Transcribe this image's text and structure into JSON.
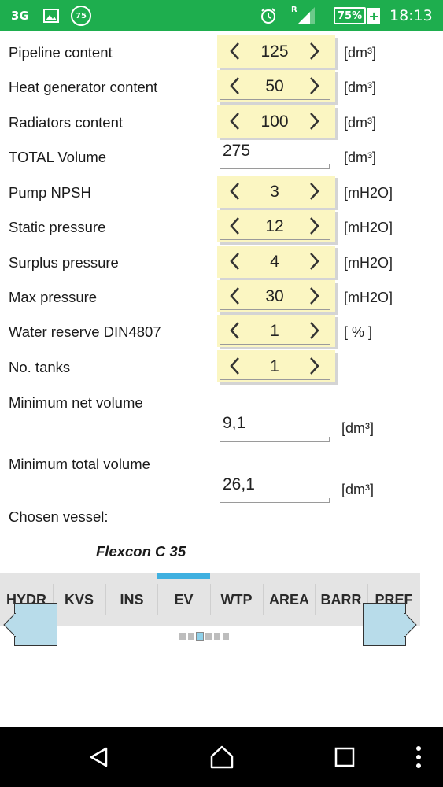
{
  "status_bar": {
    "network": "3G",
    "notification_badge": "75",
    "roaming": "R",
    "battery": "75%",
    "time": "18:13",
    "icons": [
      "network-3g-icon",
      "image-icon",
      "notification-75-icon",
      "alarm-icon",
      "signal-icon",
      "battery-charging-icon"
    ]
  },
  "form": {
    "rows": [
      {
        "label": "Pipeline content",
        "value": "125",
        "unit": "[dm³]"
      },
      {
        "label": "Heat generator content",
        "value": "50",
        "unit": "[dm³]"
      },
      {
        "label": "Radiators content",
        "value": "100",
        "unit": "[dm³]"
      },
      {
        "label": "TOTAL Volume",
        "value": "275",
        "unit": "[dm³]"
      },
      {
        "label": "Pump NPSH",
        "value": "3",
        "unit": "[mH2O]"
      },
      {
        "label": "Static pressure",
        "value": "12",
        "unit": "[mH2O]"
      },
      {
        "label": "Surplus pressure",
        "value": "4",
        "unit": "[mH2O]"
      },
      {
        "label": "Max pressure",
        "value": "30",
        "unit": "[mH2O]"
      },
      {
        "label": "Water reserve DIN4807",
        "value": "1",
        "unit": "[ % ]"
      },
      {
        "label": "No. tanks",
        "value": "1"
      }
    ],
    "min_net_volume": {
      "label": "Minimum net volume",
      "value": "9,1",
      "unit": "[dm³]"
    },
    "min_total_volume": {
      "label": "Minimum total volume",
      "value": "26,1",
      "unit": "[dm³]"
    },
    "chosen_vessel": {
      "label": "Chosen vessel:",
      "value": "Flexcon C 35"
    }
  },
  "tabs": [
    {
      "label": "HYDR"
    },
    {
      "label": "KVS"
    },
    {
      "label": "INS"
    },
    {
      "label": "EV",
      "active": true
    },
    {
      "label": "WTP"
    },
    {
      "label": "AREA"
    },
    {
      "label": "BARR"
    },
    {
      "label": "PREF"
    }
  ],
  "pager": {
    "total": 6,
    "current": 3
  },
  "colors": {
    "status_bar": "#1eae4e",
    "stepper_bg": "#fbf6c2",
    "tab_indicator": "#3fb0e0",
    "nav_arrow_bg": "#b8dcea"
  }
}
